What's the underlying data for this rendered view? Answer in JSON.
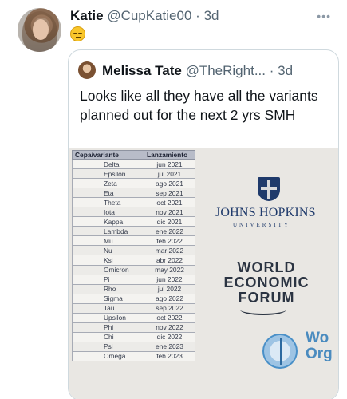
{
  "tweet": {
    "author_name": "Katie",
    "author_handle": "@CupKatie00",
    "separator": "·",
    "time": "3d",
    "more_label": "•••",
    "emoji": "expressionless-face"
  },
  "quoted": {
    "author_name": "Melissa Tate",
    "author_handle": "@TheRight...",
    "separator": "·",
    "time": "3d",
    "text": "Looks like all they have all the variants planned out for the next 2 yrs SMH"
  },
  "image": {
    "table": {
      "headers": [
        "Cepa/variante",
        "Lanzamiento"
      ],
      "rows": [
        [
          "Delta",
          "jun 2021"
        ],
        [
          "Epsilon",
          "jul 2021"
        ],
        [
          "Zeta",
          "ago 2021"
        ],
        [
          "Eta",
          "sep 2021"
        ],
        [
          "Theta",
          "oct 2021"
        ],
        [
          "Iota",
          "nov 2021"
        ],
        [
          "Kappa",
          "dic 2021"
        ],
        [
          "Lambda",
          "ene 2022"
        ],
        [
          "Mu",
          "feb 2022"
        ],
        [
          "Nu",
          "mar 2022"
        ],
        [
          "Ksi",
          "abr 2022"
        ],
        [
          "Omicron",
          "may 2022"
        ],
        [
          "Pi",
          "jun 2022"
        ],
        [
          "Rho",
          "jul 2022"
        ],
        [
          "Sigma",
          "ago 2022"
        ],
        [
          "Tau",
          "sep 2022"
        ],
        [
          "Upsilon",
          "oct 2022"
        ],
        [
          "Phi",
          "nov 2022"
        ],
        [
          "Chi",
          "dic 2022"
        ],
        [
          "Psi",
          "ene 2023"
        ],
        [
          "Omega",
          "feb 2023"
        ]
      ]
    },
    "jhu_name": "JOHNS HOPKINS",
    "jhu_sub": "UNIVERSITY",
    "wef_lines": [
      "WORLD",
      "ECONOMIC",
      "FORUM"
    ],
    "who_lines": [
      "Wo",
      "Org"
    ]
  },
  "colors": {
    "text_primary": "#0f1419",
    "text_secondary": "#536471",
    "border": "#cfd9de"
  }
}
